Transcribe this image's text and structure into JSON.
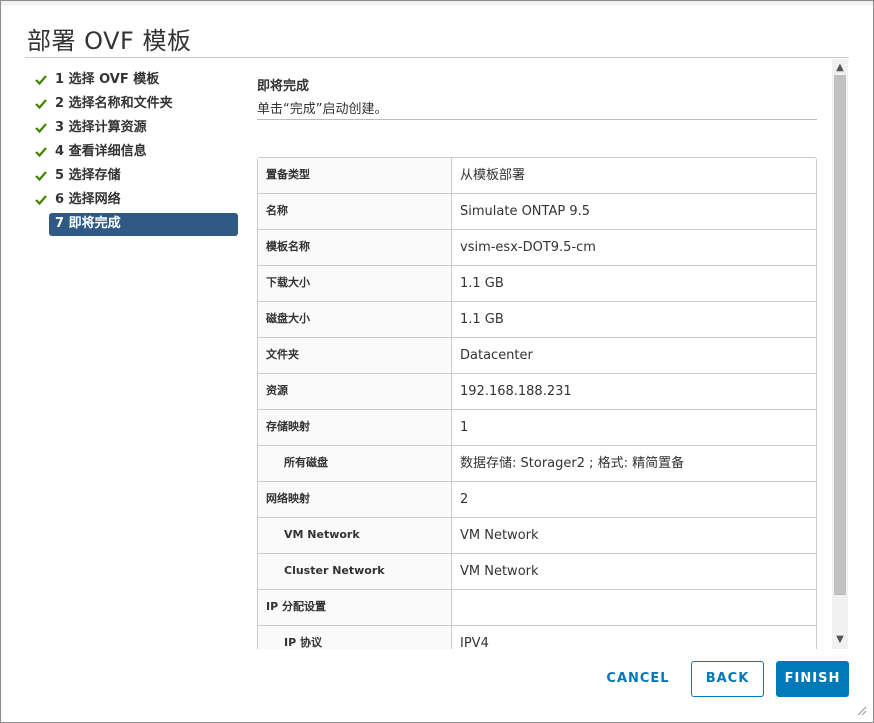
{
  "dialog": {
    "title": "部署 OVF 模板"
  },
  "steps": [
    {
      "label": "1 选择 OVF 模板",
      "done": true
    },
    {
      "label": "2 选择名称和文件夹",
      "done": true
    },
    {
      "label": "3 选择计算资源",
      "done": true
    },
    {
      "label": "4 查看详细信息",
      "done": true
    },
    {
      "label": "5 选择存储",
      "done": true
    },
    {
      "label": "6 选择网络",
      "done": true
    },
    {
      "label": "7 即将完成",
      "done": false,
      "active": true
    }
  ],
  "content": {
    "title": "即将完成",
    "description": "单击“完成”启动创建。"
  },
  "summary": [
    {
      "key": "置备类型",
      "value": "从模板部署"
    },
    {
      "key": "名称",
      "value": "Simulate ONTAP 9.5"
    },
    {
      "key": "模板名称",
      "value": "vsim-esx-DOT9.5-cm"
    },
    {
      "key": "下载大小",
      "value": "1.1 GB"
    },
    {
      "key": "磁盘大小",
      "value": "1.1 GB"
    },
    {
      "key": "文件夹",
      "value": "Datacenter"
    },
    {
      "key": "资源",
      "value": "192.168.188.231"
    },
    {
      "key": "存储映射",
      "value": "1"
    },
    {
      "key": "所有磁盘",
      "value": "数据存储: Storager2 ; 格式: 精简置备"
    },
    {
      "key": "网络映射",
      "value": "2"
    },
    {
      "key": "VM Network",
      "value": "VM Network"
    },
    {
      "key": "Cluster Network",
      "value": "VM Network"
    },
    {
      "key": "IP 分配设置",
      "value": ""
    },
    {
      "key": "IP 协议",
      "value": "IPV4"
    }
  ],
  "buttons": {
    "cancel": "CANCEL",
    "back": "BACK",
    "finish": "FINISH"
  },
  "colors": {
    "accent": "#0079b8",
    "active_step": "#2e5a85",
    "check": "#3c8500"
  }
}
